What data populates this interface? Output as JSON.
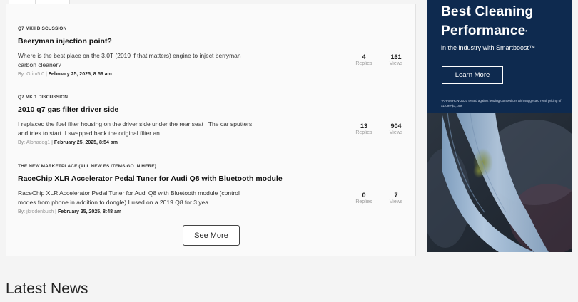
{
  "threads": [
    {
      "category": "Q7 MKII Discussion",
      "title": "Beeryman injection point?",
      "excerpt": "Where is the best place on the 3.0T (2019 if that matters) engine to inject berryman carbon cleaner?",
      "by_label": "By:",
      "author": "Grim5.0",
      "date": "February 25, 2025, 8:59 am",
      "replies": "4",
      "views": "161"
    },
    {
      "category": "Q7 MK 1 Discussion",
      "title": "2010 q7 gas filter driver side",
      "excerpt": "I replaced the fuel filter housing on the driver side under the rear seat . The car sputters and tries to start. I swapped back the original filter an...",
      "by_label": "By:",
      "author": "Alphadog1",
      "date": "February 25, 2025, 8:54 am",
      "replies": "13",
      "views": "904"
    },
    {
      "category": "The New Marketplace (All new FS Items go in here)",
      "title": "RaceChip XLR Accelerator Pedal Tuner for Audi Q8 with Bluetooth module",
      "excerpt": "RaceChip XLR Accelerator Pedal Tuner for Audi Q8 with Bluetooth module (control modes from phone in addition to dongle) I used on a 2019 Q8 for 3 yea...",
      "by_label": "By:",
      "author": "jkrodenbush",
      "date": "February 25, 2025, 8:48 am",
      "replies": "0",
      "views": "7"
    }
  ],
  "labels": {
    "replies": "Replies",
    "views": "Views",
    "see_more": "See More",
    "latest_news": "Latest News"
  },
  "ad": {
    "headline_line1": "Best Cleaning",
    "headline_line2": "Performance",
    "headline_mark": "*",
    "subline": "in the industry with Smartboost™",
    "cta": "Learn More",
    "fine_print": "*AHAM HLW-2020 tested against leading competitors with suggested retail pricing of $1,099-$1,199",
    "background_color": "#0e2a4f"
  }
}
